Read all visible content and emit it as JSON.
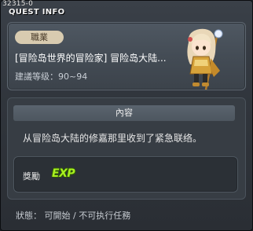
{
  "window": {
    "quest_id": "32315-0",
    "title": "QUEST INFO"
  },
  "quest": {
    "job_label": "職業",
    "name": "[冒险岛世界的冒险家] 冒险岛大陆...",
    "recommended_level": "建議等级：90~94",
    "npc_icon": "npc-portrait-icon"
  },
  "content": {
    "header": "內容",
    "text": "从冒险岛大陆的修嘉那里收到了紧急联络。"
  },
  "reward": {
    "label": "獎勵",
    "exp_label": "EXP"
  },
  "status": {
    "text": "狀態： 可開始 / 不可执行任務"
  },
  "colors": {
    "exp": "#a8f020",
    "job_badge": "#d8cbb0"
  }
}
